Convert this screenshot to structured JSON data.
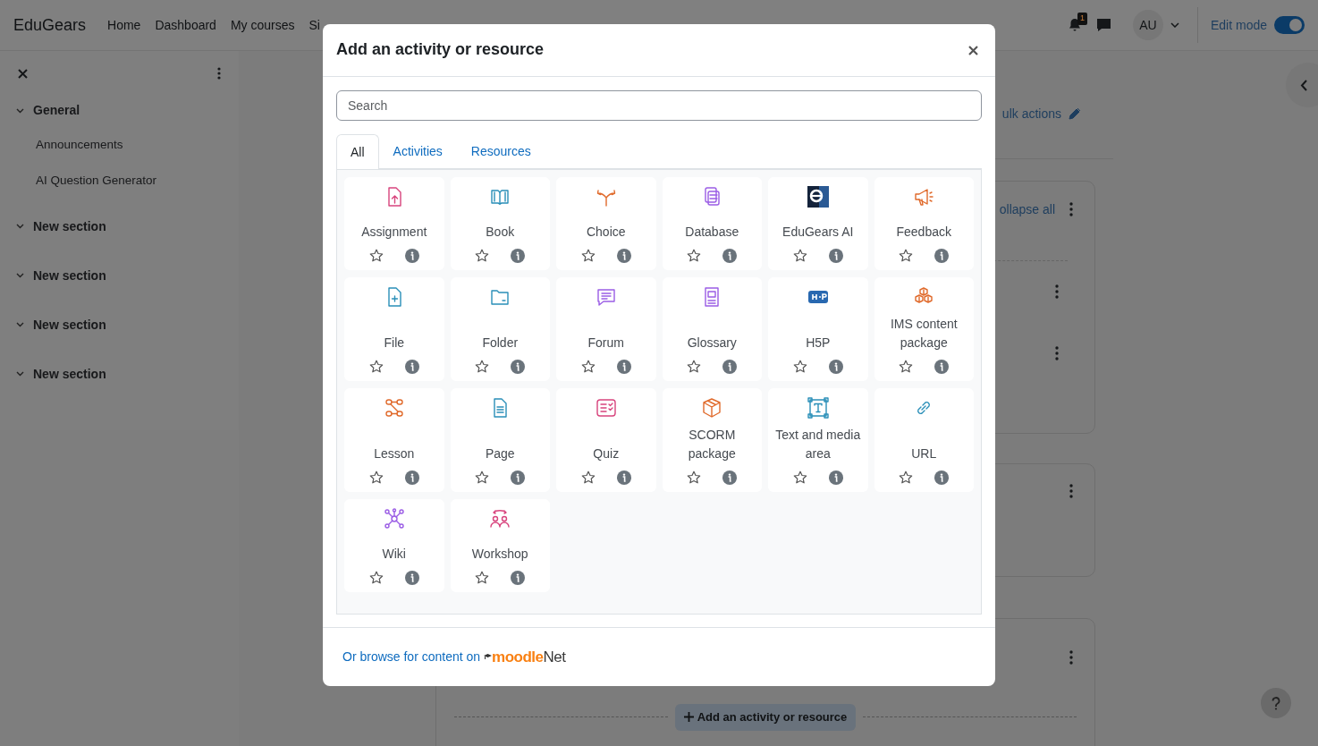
{
  "navbar": {
    "brand": "EduGears",
    "links": [
      "Home",
      "Dashboard",
      "My courses",
      "Si"
    ],
    "notification_count": "1",
    "avatar": "AU",
    "edit_mode": {
      "label": "Edit mode",
      "on": true
    }
  },
  "drawer": {
    "sections": [
      {
        "title": "General",
        "expanded": true,
        "children": [
          {
            "title": "Announcements"
          },
          {
            "title": "AI Question Generator"
          }
        ]
      },
      {
        "title": "New section",
        "expanded": true
      },
      {
        "title": "New section",
        "expanded": true
      },
      {
        "title": "New section",
        "expanded": true
      },
      {
        "title": "New section",
        "expanded": true
      }
    ]
  },
  "course": {
    "bulk_actions": "ulk actions",
    "collapse_all": "ollapse all",
    "add_button": "Add an activity or resource"
  },
  "modal": {
    "title": "Add an activity or resource",
    "search": {
      "placeholder": "Search"
    },
    "tabs": [
      {
        "label": "All",
        "selected": true
      },
      {
        "label": "Activities",
        "selected": false
      },
      {
        "label": "Resources",
        "selected": false
      }
    ],
    "items": [
      {
        "name": "Assignment",
        "starred": false
      },
      {
        "name": "Book",
        "starred": false
      },
      {
        "name": "Choice",
        "starred": false
      },
      {
        "name": "Database",
        "starred": false
      },
      {
        "name": "EduGears AI",
        "starred": false
      },
      {
        "name": "Feedback",
        "starred": false
      },
      {
        "name": "File",
        "starred": false
      },
      {
        "name": "Folder",
        "starred": false
      },
      {
        "name": "Forum",
        "starred": false
      },
      {
        "name": "Glossary",
        "starred": false
      },
      {
        "name": "H5P",
        "starred": false
      },
      {
        "name": "IMS content package",
        "starred": false
      },
      {
        "name": "Lesson",
        "starred": false
      },
      {
        "name": "Page",
        "starred": false
      },
      {
        "name": "Quiz",
        "starred": false
      },
      {
        "name": "SCORM package",
        "starred": false
      },
      {
        "name": "Text and media area",
        "starred": false
      },
      {
        "name": "URL",
        "starred": false
      },
      {
        "name": "Wiki",
        "starred": false
      },
      {
        "name": "Workshop",
        "starred": false
      }
    ],
    "footer": {
      "text": "Or browse for content on",
      "logo": [
        "moodle",
        "Net"
      ]
    }
  }
}
